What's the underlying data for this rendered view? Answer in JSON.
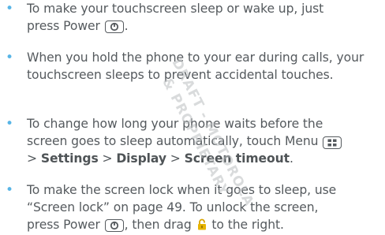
{
  "items": [
    {
      "line1": "To make your touchscreen sleep or wake up, just",
      "line2_pre": "press Power",
      "line2_post": ".",
      "power_icon": "power-icon"
    },
    {
      "text": "When you hold the phone to your ear during calls, your touchscreen sleeps to prevent accidental touches."
    },
    {
      "line1": "To change how long your phone waits before the",
      "line2_pre": "screen goes to sleep automatically, touch Menu",
      "menu_icon": "menu-icon",
      "line3_pre": "> ",
      "settings": "Settings",
      "sep1": " > ",
      "display": "Display",
      "sep2": " > ",
      "timeout": "Screen timeout",
      "line3_post": "."
    },
    {
      "line1": "To make the screen lock when it goes to sleep, use",
      "line2": "“Screen lock” on page 49. To unlock the screen,",
      "line3_pre": "press Power",
      "line3_mid": ", then drag",
      "line3_post": "to the right.",
      "lock_icon": "padlock-icon"
    }
  ],
  "watermark": {
    "line1": "DRAFT - MOTOROLA",
    "line2": "& PROPRIETARY"
  },
  "colors": {
    "bullet": "#58b5e6",
    "text": "#555a5e",
    "watermark": "#b9bdc0"
  }
}
